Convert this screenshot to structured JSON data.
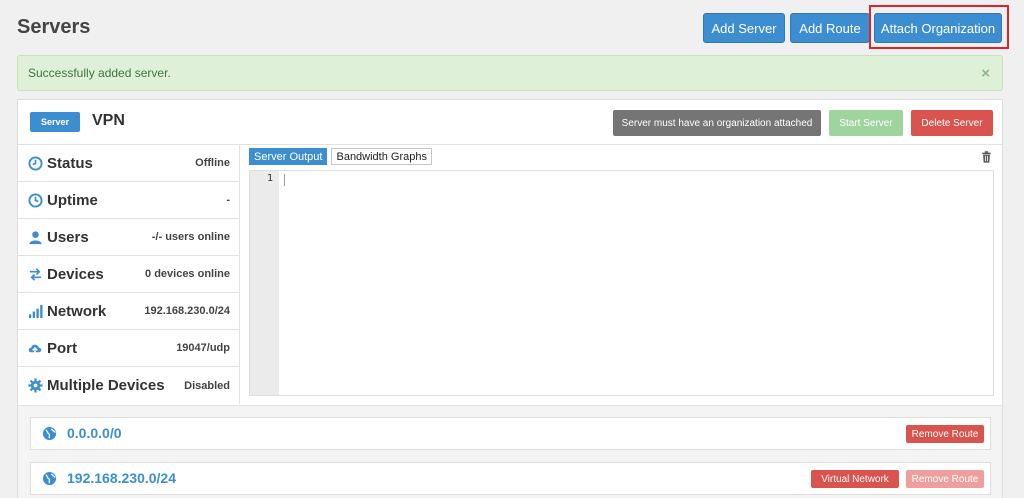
{
  "header": {
    "title": "Servers",
    "add_server": "Add Server",
    "add_route": "Add Route",
    "attach_org": "Attach Organization"
  },
  "alert": {
    "message": "Successfully added server.",
    "close": "×"
  },
  "server": {
    "badge": "Server",
    "name": "VPN",
    "org_warning": "Server must have an organization attached",
    "start": "Start Server",
    "delete": "Delete Server"
  },
  "info": [
    {
      "icon": "clock-dash-icon",
      "label": "Status",
      "value": "Offline"
    },
    {
      "icon": "clock-icon",
      "label": "Uptime",
      "value": "-"
    },
    {
      "icon": "user-icon",
      "label": "Users",
      "value": "-/- users online"
    },
    {
      "icon": "transfer-icon",
      "label": "Devices",
      "value": "0 devices online"
    },
    {
      "icon": "signal-icon",
      "label": "Network",
      "value": "192.168.230.0/24"
    },
    {
      "icon": "cloud-upload-icon",
      "label": "Port",
      "value": "19047/udp"
    },
    {
      "icon": "gear-icon",
      "label": "Multiple Devices",
      "value": "Disabled"
    }
  ],
  "output": {
    "tab_output": "Server Output",
    "tab_bandwidth": "Bandwidth Graphs",
    "line_number": "1"
  },
  "routes": [
    {
      "network": "0.0.0.0/0",
      "remove": "Remove Route"
    },
    {
      "network": "192.168.230.0/24",
      "virtual": "Virtual Network",
      "remove": "Remove Route"
    }
  ],
  "colors": {
    "primary": "#3d8ed0",
    "success_bg": "#dff0d8",
    "danger": "#d9534f",
    "muted_dark": "#757575",
    "success_btn": "#9fd49f",
    "highlight": "#e3232b"
  }
}
